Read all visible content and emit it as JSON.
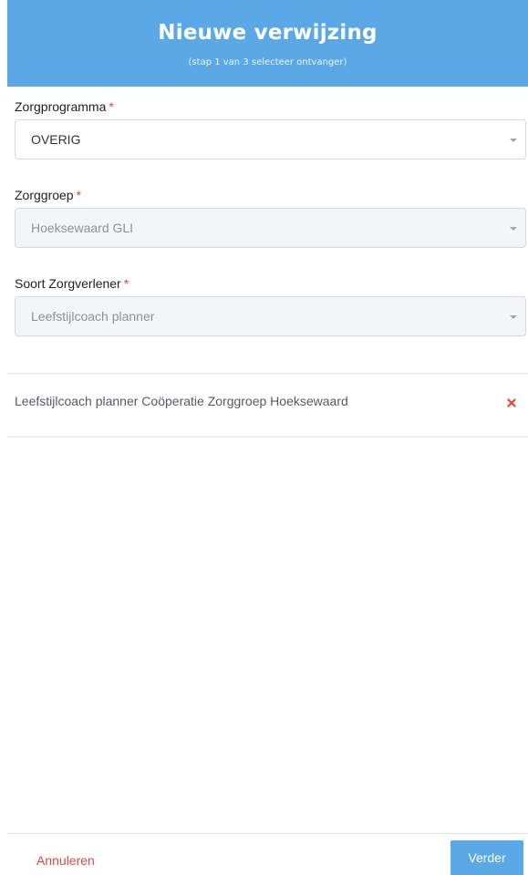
{
  "header": {
    "title": "Nieuwe verwijzing",
    "subtitle": "(stap 1 van 3 selecteer ontvanger)"
  },
  "fields": [
    {
      "label": "Zorgprogramma",
      "required_mark": "*",
      "value": "OVERIG",
      "disabled": false
    },
    {
      "label": "Zorggroep",
      "required_mark": "*",
      "value": "Hoeksewaard GLI",
      "disabled": true
    },
    {
      "label": "Soort Zorgverlener",
      "required_mark": "*",
      "value": "Leefstijlcoach planner",
      "disabled": true
    }
  ],
  "recipient": {
    "text": "Leefstijlcoach planner Coöperatie Zorggroep Hoeksewaard",
    "remove_icon": "close-icon"
  },
  "footer": {
    "cancel_label": "Annuleren",
    "next_label": "Verder"
  },
  "colors": {
    "accent": "#5aa9e6",
    "danger": "#e0473c"
  }
}
